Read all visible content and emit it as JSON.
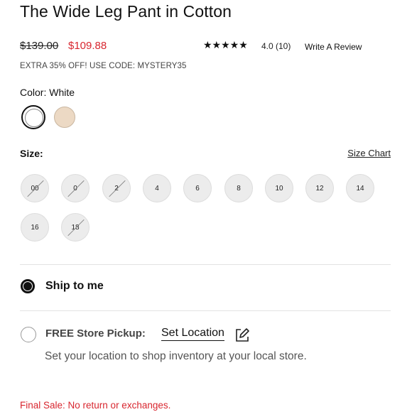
{
  "product": {
    "title": "The Wide Leg Pant in Cotton",
    "original_price": "$139.00",
    "sale_price": "$109.88",
    "rating_stars": "★★★★★",
    "rating": "4.0 (10)",
    "write_review": "Write A Review",
    "promo": "EXTRA 35% OFF! USE CODE: MYSTERY35"
  },
  "color": {
    "label": "Color:",
    "selected": "White",
    "swatches": [
      {
        "name": "White",
        "hex": "#ffffff",
        "selected": true
      },
      {
        "name": "Beige",
        "hex": "#ecd9c4",
        "selected": false
      }
    ]
  },
  "size": {
    "label": "Size:",
    "chart_link": "Size Chart",
    "options": [
      {
        "label": "00",
        "available": false
      },
      {
        "label": "0",
        "available": false
      },
      {
        "label": "2",
        "available": false
      },
      {
        "label": "4",
        "available": true
      },
      {
        "label": "6",
        "available": true
      },
      {
        "label": "8",
        "available": true
      },
      {
        "label": "10",
        "available": true
      },
      {
        "label": "12",
        "available": true
      },
      {
        "label": "14",
        "available": true
      },
      {
        "label": "16",
        "available": true
      },
      {
        "label": "18",
        "available": false
      }
    ]
  },
  "shipping": {
    "ship_to_me": "Ship to me",
    "ship_selected": true,
    "pickup_label": "FREE Store Pickup:",
    "set_location": "Set Location",
    "location_description": "Set your location to shop inventory at your local store."
  },
  "final_sale": "Final Sale: No return or exchanges.",
  "colors": {
    "sale_red": "#d8262f",
    "text": "#111111"
  },
  "icons": {
    "edit": "pencil-square-icon"
  }
}
